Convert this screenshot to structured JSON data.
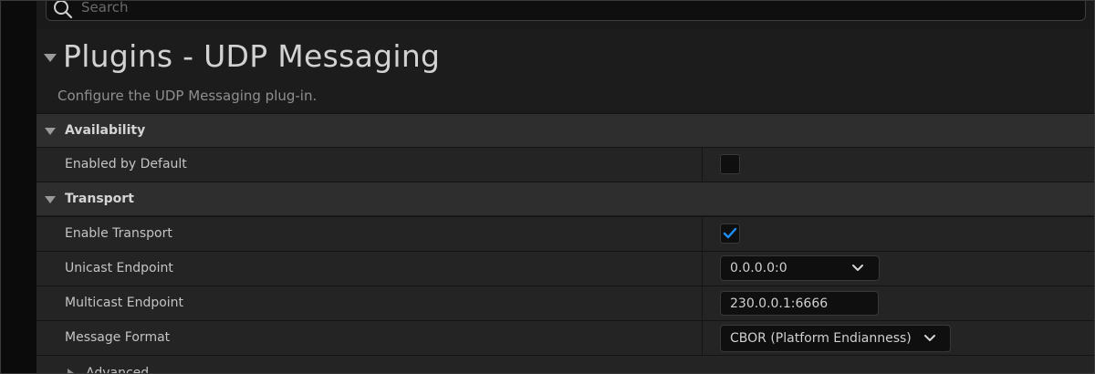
{
  "search": {
    "placeholder": "Search"
  },
  "header": {
    "title": "Plugins - UDP Messaging",
    "description": "Configure the UDP Messaging plug-in."
  },
  "sections": {
    "availability": {
      "label": "Availability",
      "enabled_by_default": {
        "label": "Enabled by Default",
        "checked": false
      }
    },
    "transport": {
      "label": "Transport",
      "enable_transport": {
        "label": "Enable Transport",
        "checked": true
      },
      "unicast_endpoint": {
        "label": "Unicast Endpoint",
        "value": "0.0.0.0:0"
      },
      "multicast_endpoint": {
        "label": "Multicast Endpoint",
        "value": "230.0.0.1:6666"
      },
      "message_format": {
        "label": "Message Format",
        "value": "CBOR (Platform Endianness)"
      },
      "advanced": {
        "label": "Advanced"
      }
    }
  },
  "colors": {
    "accent_check": "#1e8fff",
    "section_bg": "#2e2e2e",
    "row_bg": "#242424"
  },
  "icons": {
    "search": "search-icon",
    "check": "check-icon",
    "dropdown": "chevron-down-icon",
    "collapse_expanded": "caret-down-icon",
    "collapse_collapsed": "caret-right-icon"
  }
}
